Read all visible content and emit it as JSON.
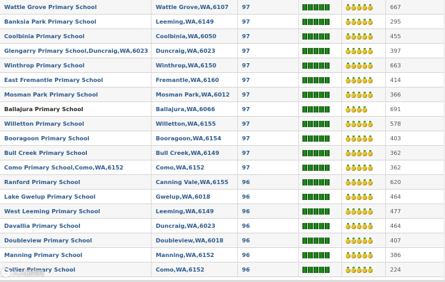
{
  "rows": [
    {
      "school": "Wattle Grove Primary School",
      "location": "Wattle Grove,WA,6107",
      "score": "97",
      "books": 5,
      "pineapples": 5,
      "count": "667",
      "dark": false
    },
    {
      "school": "Banksia Park Primary School",
      "location": "Leeming,WA,6149",
      "score": "97",
      "books": 5,
      "pineapples": 5,
      "count": "295",
      "dark": false
    },
    {
      "school": "Coolbinia Primary School",
      "location": "Coolbinia,WA,6050",
      "score": "97",
      "books": 5,
      "pineapples": 5,
      "count": "455",
      "dark": false
    },
    {
      "school": "Glengarry Primary School,Duncraig,WA,6023",
      "location": "Duncraig,WA,6023",
      "score": "97",
      "books": 5,
      "pineapples": 5,
      "count": "397",
      "dark": false
    },
    {
      "school": "Winthrop Primary School",
      "location": "Winthrop,WA,6150",
      "score": "97",
      "books": 5,
      "pineapples": 5,
      "count": "663",
      "dark": false
    },
    {
      "school": "East Fremantle Primary School",
      "location": "Fremantle,WA,6160",
      "score": "97",
      "books": 5,
      "pineapples": 5,
      "count": "414",
      "dark": false
    },
    {
      "school": "Mosman Park Primary School",
      "location": "Mosman Park,WA,6012",
      "score": "97",
      "books": 5,
      "pineapples": 5,
      "count": "366",
      "dark": false
    },
    {
      "school": "Ballajura Primary School",
      "location": "Ballajura,WA,6066",
      "score": "97",
      "books": 5,
      "pineapples": 4,
      "count": "691",
      "dark": true
    },
    {
      "school": "Willetton Primary School",
      "location": "Willetton,WA,6155",
      "score": "97",
      "books": 5,
      "pineapples": 5,
      "count": "578",
      "dark": false
    },
    {
      "school": "Booragoon Primary School",
      "location": "Booragoon,WA,6154",
      "score": "97",
      "books": 5,
      "pineapples": 5,
      "count": "403",
      "dark": false
    },
    {
      "school": "Bull Creek Primary School",
      "location": "Bull Creek,WA,6149",
      "score": "97",
      "books": 5,
      "pineapples": 5,
      "count": "362",
      "dark": false
    },
    {
      "school": "Como Primary School,Como,WA,6152",
      "location": "Como,WA,6152",
      "score": "97",
      "books": 5,
      "pineapples": 5,
      "count": "362",
      "dark": false
    },
    {
      "school": "Ranford Primary School",
      "location": "Canning Vale,WA,6155",
      "score": "96",
      "books": 5,
      "pineapples": 5,
      "count": "620",
      "dark": false
    },
    {
      "school": "Lake Gwelup Primary School",
      "location": "Gwelup,WA,6018",
      "score": "96",
      "books": 5,
      "pineapples": 5,
      "count": "464",
      "dark": false
    },
    {
      "school": "West Leeming Primary School",
      "location": "Leeming,WA,6149",
      "score": "96",
      "books": 5,
      "pineapples": 5,
      "count": "477",
      "dark": false
    },
    {
      "school": "Davallia Primary School",
      "location": "Duncraig,WA,6023",
      "score": "96",
      "books": 5,
      "pineapples": 5,
      "count": "464",
      "dark": false
    },
    {
      "school": "Doubleview Primary School",
      "location": "Doubleview,WA,6018",
      "score": "96",
      "books": 5,
      "pineapples": 5,
      "count": "407",
      "dark": false
    },
    {
      "school": "Manning Primary School",
      "location": "Manning,WA,6152",
      "score": "96",
      "books": 5,
      "pineapples": 5,
      "count": "386",
      "dark": false
    },
    {
      "school": "Collier Primary School",
      "location": "Como,WA,6152",
      "score": "96",
      "books": 5,
      "pineapples": 5,
      "count": "224",
      "dark": false
    }
  ],
  "icons": {
    "performance": "book-icon",
    "value": "pineapple-icon",
    "watermark": "watermark-logo-icon"
  },
  "colors": {
    "link": "#2f5c8e",
    "book_green": "#1f8a23",
    "pineapple_yellow": "#e2c33a",
    "row_alt": "#f6f6f6"
  },
  "watermark": {
    "text": "人人新闻网"
  }
}
